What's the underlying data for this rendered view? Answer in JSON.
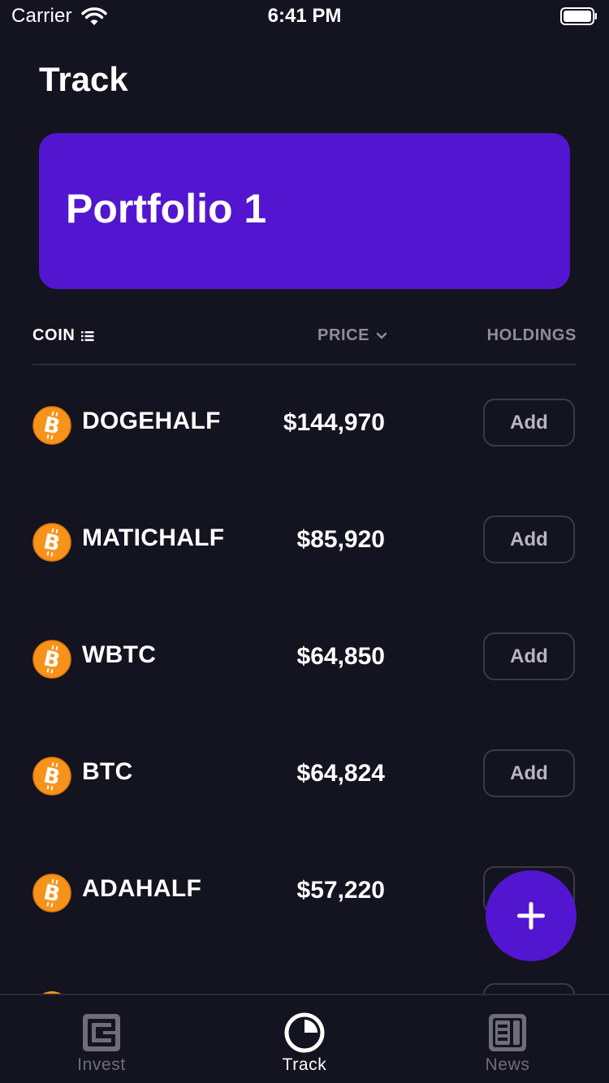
{
  "status_bar": {
    "carrier": "Carrier",
    "time": "6:41 PM"
  },
  "header": {
    "title": "Track"
  },
  "portfolio": {
    "name": "Portfolio 1",
    "card_color": "#5316d0"
  },
  "columns": {
    "coin": "COIN",
    "price": "PRICE",
    "holdings": "HOLDINGS"
  },
  "coins": [
    {
      "name": "DOGEHALF",
      "price": "$144,970",
      "action": "Add",
      "icon": "bitcoin-icon"
    },
    {
      "name": "MATICHALF",
      "price": "$85,920",
      "action": "Add",
      "icon": "bitcoin-icon"
    },
    {
      "name": "WBTC",
      "price": "$64,850",
      "action": "Add",
      "icon": "bitcoin-icon"
    },
    {
      "name": "BTC",
      "price": "$64,824",
      "action": "Add",
      "icon": "bitcoin-icon"
    },
    {
      "name": "ADAHALF",
      "price": "$57,220",
      "action": "Add",
      "icon": "bitcoin-icon"
    },
    {
      "name": "",
      "price": "",
      "action": "",
      "icon": "bitcoin-icon"
    }
  ],
  "fab": {
    "icon": "plus-icon"
  },
  "tabs": [
    {
      "label": "Invest",
      "icon": "wallet-icon",
      "active": false
    },
    {
      "label": "Track",
      "icon": "pie-chart-icon",
      "active": true
    },
    {
      "label": "News",
      "icon": "newspaper-icon",
      "active": false
    }
  ],
  "colors": {
    "background": "#141320",
    "accent": "#5316d0",
    "muted_text": "#8e8d98",
    "coin_orange": "#f7931a"
  }
}
